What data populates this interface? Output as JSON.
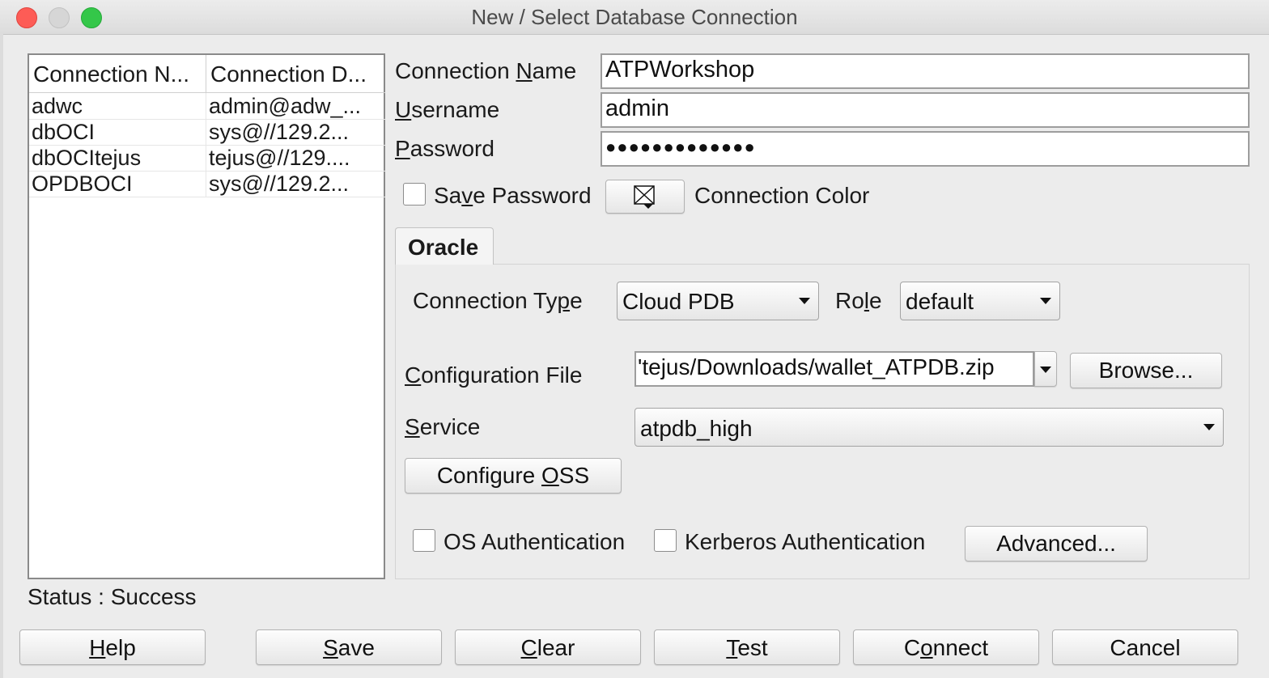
{
  "window": {
    "title": "New / Select Database Connection"
  },
  "connections_table": {
    "columns": [
      "Connection N...",
      "Connection D..."
    ],
    "rows": [
      [
        "adwc",
        "admin@adw_..."
      ],
      [
        "dbOCI",
        "sys@//129.2..."
      ],
      [
        "dbOCItejus",
        "tejus@//129...."
      ],
      [
        "OPDBOCI",
        "sys@//129.2..."
      ]
    ]
  },
  "form": {
    "connection_name": {
      "label_pre": "Connection ",
      "label_u": "N",
      "label_post": "ame",
      "value": "ATPWorkshop"
    },
    "username": {
      "label_pre": "",
      "label_u": "U",
      "label_post": "sername",
      "value": "admin"
    },
    "password": {
      "label_pre": "",
      "label_u": "P",
      "label_post": "assword",
      "value": "●●●●●●●●●●●●●"
    },
    "save_password": {
      "label_pre": "Sa",
      "label_u": "v",
      "label_post": "e Password",
      "checked": false
    },
    "connection_color": {
      "label": "Connection Color"
    }
  },
  "tab": {
    "label": "Oracle"
  },
  "oracle": {
    "connection_type": {
      "label_pre": "Connection Ty",
      "label_u": "p",
      "label_post": "e",
      "value": "Cloud PDB"
    },
    "role": {
      "label_pre": "Ro",
      "label_u": "l",
      "label_post": "e",
      "value": "default"
    },
    "config_file": {
      "label_pre": "",
      "label_u": "C",
      "label_post": "onfiguration File",
      "value": "'tejus/Downloads/wallet_ATPDB.zip"
    },
    "browse_label": "Browse...",
    "service": {
      "label_pre": "",
      "label_u": "S",
      "label_post": "ervice",
      "value": "atpdb_high"
    },
    "configure_oss": {
      "pre": "Configure ",
      "u": "O",
      "post": "SS"
    },
    "os_auth_label": "OS Authentication",
    "kerberos_auth_label": "Kerberos Authentication",
    "advanced_label": "Advanced..."
  },
  "status": {
    "text": "Status : Success"
  },
  "buttons": {
    "help": {
      "u": "H",
      "rest": "elp"
    },
    "save": {
      "u": "S",
      "rest": "ave"
    },
    "clear": {
      "u": "C",
      "rest": "lear"
    },
    "test": {
      "u": "T",
      "rest": "est"
    },
    "connect": {
      "pre": "C",
      "u": "o",
      "rest": "nnect"
    },
    "cancel": {
      "label": "Cancel"
    }
  }
}
